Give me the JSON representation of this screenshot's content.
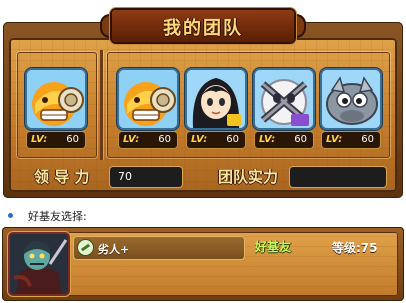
{
  "panel": {
    "title": "我的团队"
  },
  "team": {
    "leader": {
      "portrait": "orange-mech-creature-icon",
      "level_label": "LV:",
      "level": "60"
    },
    "members": [
      {
        "portrait": "orange-mech-creature-icon",
        "level_label": "LV:",
        "level": "60"
      },
      {
        "portrait": "dark-haired-girl-icon",
        "level_label": "LV:",
        "level": "60"
      },
      {
        "portrait": "white-bandaged-creature-icon",
        "level_label": "LV:",
        "level": "60"
      },
      {
        "portrait": "gray-rhino-creature-icon",
        "level_label": "LV:",
        "level": "60"
      }
    ]
  },
  "stats": {
    "leadership_label": "领 导 力",
    "leadership_value": "70",
    "team_power_label": "团队实力",
    "team_power_value": ""
  },
  "friend_section": {
    "heading": "好基友选择:",
    "friend": {
      "avatar": "zombie-warrior-icon",
      "name": "劣人+",
      "tag": "好基友",
      "level_text": "等级:75"
    }
  },
  "colors": {
    "frame_brown": "#8a5523",
    "parchment": "#e0a34a",
    "title_gold": "#ffd97a",
    "friend_tag_green": "#c9f45a"
  }
}
